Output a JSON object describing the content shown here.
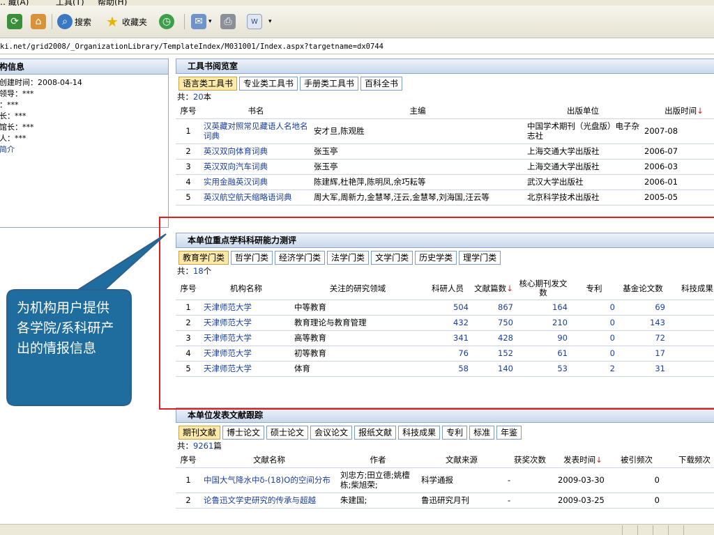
{
  "menubar": {
    "fragments": [
      "… 藏(A)",
      "工具(T)",
      "帮助(H)"
    ]
  },
  "toolbar": {
    "refresh_icon": "refresh-icon",
    "home_icon": "home-icon",
    "search_label": "搜索",
    "favorites_label": "收藏夹",
    "history_icon": "history-icon",
    "mail_icon": "mail-icon",
    "print_icon": "print-icon",
    "edit_icon": "word-edit-icon",
    "dropdown_glyph": "▾"
  },
  "address": {
    "url": "ki.net/grid2008/_OrganizationLibrary/TemplateIndex/M031001/Index.aspx?targetname=dx0744"
  },
  "left_panel": {
    "title": "构信息",
    "items": [
      "创建时间：2008-04-14",
      "领导：***",
      "：***",
      "长：***",
      "馆长：***",
      "人：***"
    ],
    "intro_link": "简介"
  },
  "section1": {
    "title": "工具书阅览室",
    "tabs": [
      "语言类工具书",
      "专业类工具书",
      "手册类工具书",
      "百科全书"
    ],
    "count_prefix": "共：",
    "count": "20",
    "count_suffix": "本",
    "headers": [
      "序号",
      "书名",
      "主编",
      "出版单位",
      "出版时间"
    ],
    "sort_arrow": "↓",
    "rows": [
      {
        "no": "1",
        "name": "汉英藏对照常见藏语人名地名词典",
        "editor": "安才旦,陈观胜",
        "publisher": "中国学术期刊（光盘版）电子杂志社",
        "date": "2007-08"
      },
      {
        "no": "2",
        "name": "英汉双向体育词典",
        "editor": "张玉亭",
        "publisher": "上海交通大学出版社",
        "date": "2006-07"
      },
      {
        "no": "3",
        "name": "英汉双向汽车词典",
        "editor": "张玉亭",
        "publisher": "上海交通大学出版社",
        "date": "2006-03"
      },
      {
        "no": "4",
        "name": "实用金融英汉词典",
        "editor": "陈建辉,杜艳萍,陈明凤,余巧耘等",
        "publisher": "武汉大学出版社",
        "date": "2006-01"
      },
      {
        "no": "5",
        "name": "英汉航空航天缩略语词典",
        "editor": "周大军,周新力,金慧琴,汪云,金慧琴,刘海国,汪云等",
        "publisher": "北京科学技术出版社",
        "date": "2005-05"
      }
    ]
  },
  "section2": {
    "title": "本单位重点学科科研能力测评",
    "tabs": [
      "教育学门类",
      "哲学门类",
      "经济学门类",
      "法学门类",
      "文学门类",
      "历史学类",
      "理学门类"
    ],
    "count_prefix": "共：",
    "count": "18",
    "count_suffix": "个",
    "headers": [
      "序号",
      "机构名称",
      "关注的研究领域",
      "科研人员",
      "文献篇数",
      "核心期刊发文数",
      "专利",
      "基金论文数",
      "科技成果"
    ],
    "sort_arrow": "↓",
    "rows": [
      {
        "no": "1",
        "org": "天津师范大学",
        "field": "中等教育",
        "staff": "504",
        "docs": "867",
        "core": "164",
        "patent": "0",
        "fund": "69"
      },
      {
        "no": "2",
        "org": "天津师范大学",
        "field": "教育理论与教育管理",
        "staff": "432",
        "docs": "750",
        "core": "210",
        "patent": "0",
        "fund": "143"
      },
      {
        "no": "3",
        "org": "天津师范大学",
        "field": "高等教育",
        "staff": "341",
        "docs": "428",
        "core": "90",
        "patent": "0",
        "fund": "72"
      },
      {
        "no": "4",
        "org": "天津师范大学",
        "field": "初等教育",
        "staff": "76",
        "docs": "152",
        "core": "61",
        "patent": "0",
        "fund": "17"
      },
      {
        "no": "5",
        "org": "天津师范大学",
        "field": "体育",
        "staff": "58",
        "docs": "140",
        "core": "53",
        "patent": "2",
        "fund": "31"
      }
    ]
  },
  "section3": {
    "title": "本单位发表文献跟踪",
    "tabs": [
      "期刊文献",
      "博士论文",
      "硕士论文",
      "会议论文",
      "报纸文献",
      "科技成果",
      "专利",
      "标准",
      "年鉴"
    ],
    "count_prefix": "共：",
    "count": "9261",
    "count_suffix": "篇",
    "headers": [
      "序号",
      "文献名称",
      "作者",
      "文献来源",
      "获奖次数",
      "发表时间",
      "被引频次",
      "下载频次"
    ],
    "sort_arrow": "↓",
    "rows": [
      {
        "no": "1",
        "title": "中国大气降水中δ-(18)O的空间分布",
        "author": "刘忠方;田立德;姚檀栋;柴旭荣;",
        "source": "科学通报",
        "awards": "-",
        "date": "2009-03-30",
        "cited": "0"
      },
      {
        "no": "2",
        "title": "论鲁迅文学史研究的传承与超越",
        "author": "朱建国;",
        "source": "鲁迅研究月刊",
        "awards": "-",
        "date": "2009-03-25",
        "cited": "0"
      }
    ]
  },
  "callout": {
    "text": "为机构用户提供各学院/系科研产出的情报信息",
    "fill": "#1f6c9e",
    "border": "#2f5f8c"
  },
  "highlight_color": "#e01c1c"
}
